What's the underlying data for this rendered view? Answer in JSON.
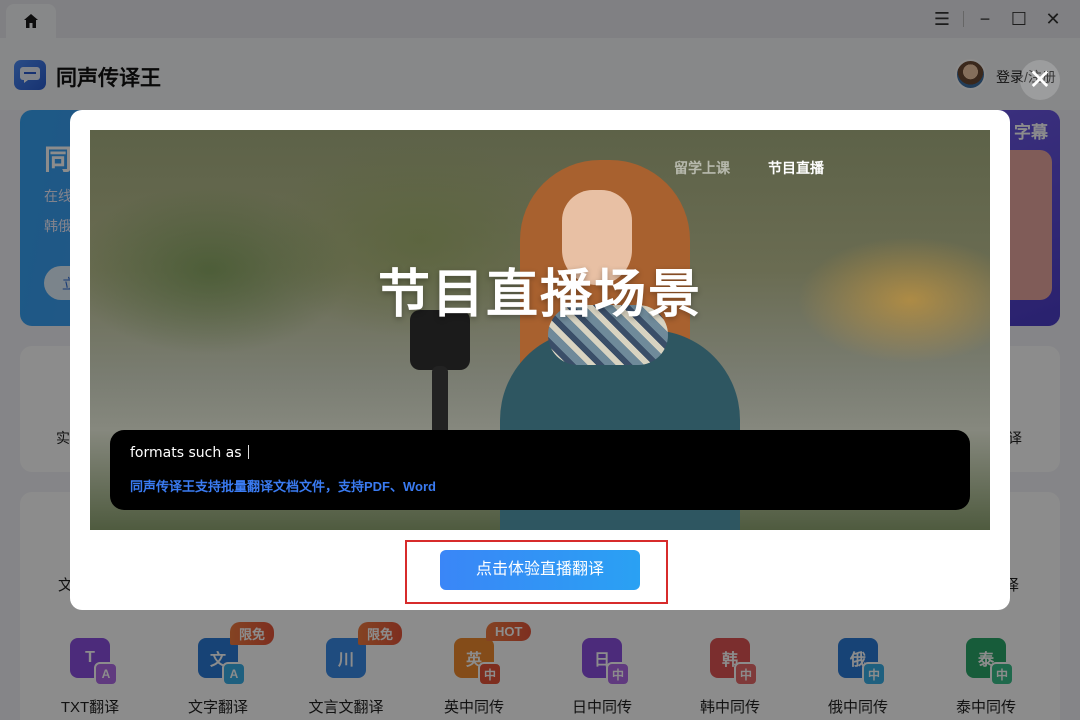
{
  "app": {
    "title": "同声传译王",
    "login": "登录/注册",
    "window_controls": {
      "menu": "☰",
      "minimize": "−",
      "maximize": "☐",
      "close": "✕"
    }
  },
  "banner": {
    "title_partial": "同",
    "line1_partial": "在线",
    "line2_partial": "韩俄",
    "button_partial": "立",
    "subtitle_partial": "字幕"
  },
  "feature_row": {
    "left_partial": "实",
    "right_partial": "译"
  },
  "tools_row": {
    "left_partial": "文",
    "right_partial": "译"
  },
  "tools": [
    {
      "label": "TXT翻译",
      "icon": "txt-translate-icon",
      "glyph": "T",
      "sub": "A",
      "color": "#8a4fe0",
      "sub_color": "#b06be8",
      "badge": ""
    },
    {
      "label": "文字翻译",
      "icon": "text-translate-icon",
      "glyph": "文",
      "sub": "A",
      "color": "#2a7bd8",
      "sub_color": "#3ab0e8",
      "badge": "限免"
    },
    {
      "label": "文言文翻译",
      "icon": "classical-chinese-icon",
      "glyph": "川",
      "sub": "",
      "color": "#3a8be8",
      "sub_color": "#3a8be8",
      "badge": "限免"
    },
    {
      "label": "英中同传",
      "icon": "en-zh-interpret-icon",
      "glyph": "英",
      "sub": "中",
      "color": "#f08a2f",
      "sub_color": "#e5553a",
      "badge": "HOT"
    },
    {
      "label": "日中同传",
      "icon": "ja-zh-interpret-icon",
      "glyph": "日",
      "sub": "中",
      "color": "#8a4fe0",
      "sub_color": "#b06be8",
      "badge": ""
    },
    {
      "label": "韩中同传",
      "icon": "ko-zh-interpret-icon",
      "glyph": "韩",
      "sub": "中",
      "color": "#e05555",
      "sub_color": "#e86a6a",
      "badge": ""
    },
    {
      "label": "俄中同传",
      "icon": "ru-zh-interpret-icon",
      "glyph": "俄",
      "sub": "中",
      "color": "#2a7bd8",
      "sub_color": "#3ab0e8",
      "badge": ""
    },
    {
      "label": "泰中同传",
      "icon": "th-zh-interpret-icon",
      "glyph": "泰",
      "sub": "中",
      "color": "#2aa86a",
      "sub_color": "#3ac08a",
      "badge": ""
    }
  ],
  "modal": {
    "close": "✕",
    "tabs": [
      "留学上课",
      "节目直播"
    ],
    "active_tab": "节目直播",
    "scene_title": "节目直播场景",
    "caption_en": "formats such as",
    "caption_zh": "同声传译王支持批量翻译文档文件，支持PDF、Word",
    "cta": "点击体验直播翻译"
  }
}
